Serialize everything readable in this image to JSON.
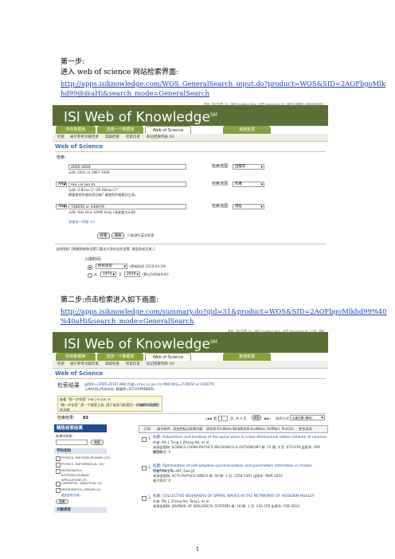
{
  "doc": {
    "step1": "第一步:",
    "step1_desc": "进入 web of science  网站检索界面:",
    "url1_line1": "http://apps.isiknowledge.com/WOS_GeneralSearch_input.do?product=WOS&SID=2AOFbgoMlk",
    "url1_line2": "hd99@@aHi&search_mode=GeneralSearch",
    "step2": "第二步:点击检索进入如下画面:",
    "url2_line1": "http://apps.isiknowledge.com/summary.do?qid=31&product=WOS&SID=2AOFbgoMlkhd99%40",
    "url2_line2": "%40aHi&search_mode=GeneralSearch",
    "page_number": "1"
  },
  "shot1": {
    "header_links": "登录 | 标记列表 (0) | 我的 EndNote Web | 我的 ResearcherID | 我的引用跟踪 | 我保存的检索 | 注销 | 帮助",
    "logo": "ISI Web of Knowledge",
    "logo_sm": "SM",
    "tabs": [
      "所有数据库",
      "选择一个数据库",
      "Web of Science",
      "其他资源"
    ],
    "subnav": [
      "检索",
      "被引参考文献检索",
      "高级检索",
      "检索历史",
      "标记结果列表 (0)"
    ],
    "wos_title": "Web of Science",
    "search_label": "检索:",
    "rows": [
      {
        "bool": "",
        "value": "2005-2010",
        "hint1": "示例: 2001 or 1997-1999",
        "hint2": "",
        "field": "出版年"
      },
      {
        "bool": "AND",
        "value": "ma j or jun m",
        "hint1": "示例: O'Brian C* OR OBrian C*",
        "hint2": "需要使用作者检索功能? 请使用作者甄别工具。",
        "field": "作者"
      },
      {
        "bool": "AND",
        "value": "730050 or 430079",
        "hint1": "示例: Yale Univ SAME hosp (请查看与示例)",
        "hint2": "",
        "field": "地址"
      }
    ],
    "field_label": "检索范围",
    "add_field": "添加另一字段 >>",
    "search_btn": "检索",
    "clear_btn": "清除",
    "search_note": "只能进行英文检索",
    "current_limits": "当前限制: [隐藏限制和设置] [要永久保存这些设置, 请登录或注册。]",
    "time_label": "入库时间:",
    "time_opt1": "所有年份",
    "time_opt1_note": "(更新时间 2010-03-29)",
    "time_opt2_from": "从",
    "time_opt2_from_year": "1975",
    "time_opt2_to": "至",
    "time_opt2_to_year": "2010",
    "time_opt2_note": "(默认为所有年份)"
  },
  "shot2": {
    "header_links": "登录 | 标记列表 (0) | 我的 EndNote Web | 我的 ResearcherID | 注销 | 帮助",
    "logo": "ISI Web of Knowledge",
    "logo_sm": "SM",
    "tabs": [
      "所有数据库",
      "选择一个数据库",
      "Web of Science",
      "其他资源"
    ],
    "subnav": [
      "检索",
      "被引参考文献检索",
      "高级检索",
      "检索历史",
      "标记结果列表 (0)"
    ],
    "wos_title": "Web of Science",
    "results_label": "检索结果",
    "results_query": "出版年=(2005-2010) AND 作者=(ma j or jun m) AND 地址=(730050 or 430079)",
    "results_db": "入库时间=所有年份. 数据库=SCI-EXPANDED.",
    "ask_title": "查看 \"检一步检索\" ma j or jun m",
    "ask_line": "\"精一步检索\" 是一个搜索工具, 用于查找可能是同一作者的人员撰写的文献",
    "ask_link": "(了解更多信息)",
    "count_label": "检索结果:",
    "count": "83",
    "page_label": "第",
    "page": "1",
    "page_total": "页, 共 4 页",
    "go": "转到",
    "sort_label": "排序方式:",
    "sort_value": "出版日期 (降序)",
    "refine_title": "精炼检索结果",
    "refine_sub": "结果内检索",
    "refine_btn": "检索",
    "facet1": "学科类别",
    "facet1_items": [
      "PHYSICS, MULTIDISCIPLINARY (15)",
      "PHYSICS, MATHEMATICAL (10)",
      "MATHEMATICS, INTERDISCIPLINARY APPLICATIONS (9)",
      "CHEMISTRY, ANALYTICAL (5)",
      "MATHEMATICS, APPLIED (4)"
    ],
    "more": "更多选项/分类...",
    "facet2": "文献类型",
    "toolbar": [
      "打印",
      "电子邮件",
      "添加到标记结果列表",
      "保存到 EndNote Web",
      "保存到 EndNote, RefMan, ProCite",
      "更多选项"
    ],
    "results": [
      {
        "num": "1.",
        "title": "标题: Robustness and breakup of the spiral wave in a two-dimensional lattice network of neurons",
        "author": "作者: Ma J, Tang J, Zhang AH, et al.",
        "source": "来源出版物: SCIENCE CHINA-PHYSICS MECHANICS & ASTRONOMY  卷: 53  期: 4  页: 672-679  出版年: APR 2010",
        "cited": "被引频次: 0"
      },
      {
        "num": "2.",
        "title": "标题: Optimization of self-adaptive synchronization and parameters estimation in chaotic Hindmarsh",
        "author": "作者: Ma J, Su WT, Gao JZ",
        "source": "来源出版物: ACTA PHYSICA SINICA  卷: 59  期: 3  页: 1554-1561  出版年: MAR 2010",
        "cited": "被引频次: 0"
      },
      {
        "num": "3.",
        "title": "标题: COLLECTIVE BEHAVIORS OF SPIRAL WAVES IN THE NETWORKS OF HODGKIN-HUXLEY",
        "author": "作者: Ma J, Zhang AH, Tang J, et al.",
        "source": "来源出版物: JOURNAL OF BIOLOGICAL SYSTEMS  卷: 18  期: 1  页: 243-259  出版年: FEB 2010",
        "cited": ""
      }
    ]
  },
  "colors": {
    "banner": "#5a6e35",
    "tab": "#86a240",
    "link": "#1a3ec8",
    "refine_head": "#1f4d8c"
  }
}
